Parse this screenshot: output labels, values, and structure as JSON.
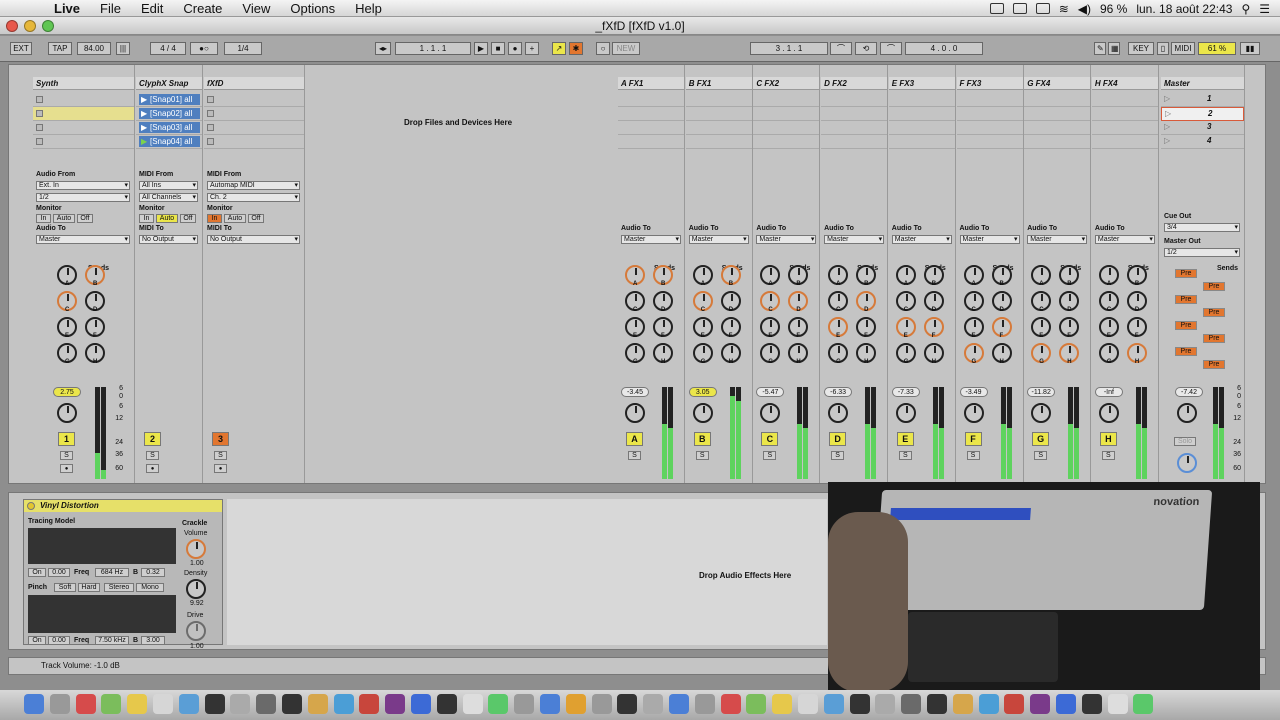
{
  "menubar": {
    "app": "Live",
    "items": [
      "File",
      "Edit",
      "Create",
      "View",
      "Options",
      "Help"
    ],
    "battery": "96 %",
    "datetime": "lun. 18 août  22:43"
  },
  "window": {
    "title": "_fXfD  [fXfD v1.0]"
  },
  "transport": {
    "ext": "EXT",
    "tap": "TAP",
    "bpm": "84.00",
    "signature": "4 / 4",
    "quant": "1/4",
    "position": "1 .  1 .  1",
    "new": "NEW",
    "loop_start": "3 .  1 .  1",
    "loop_len": "4 .  0 .  0",
    "key": "KEY",
    "midi": "MIDI",
    "cpu": "61 %"
  },
  "tracks": [
    {
      "name": "Synth",
      "from_label": "Audio From",
      "from": "Ext. In",
      "channel": "1/2",
      "to_label": "Audio To",
      "to": "Master",
      "vol": "2.75",
      "num": "1"
    },
    {
      "name": "ClyphX Snap",
      "from_label": "MIDI From",
      "from": "All Ins",
      "channel": "All Channels",
      "to_label": "MIDI To",
      "to": "No Output",
      "num": "2",
      "snaps": [
        "[Snap01] all",
        "[Snap02] all",
        "[Snap03] all",
        "[Snap04] all"
      ]
    },
    {
      "name": "fXfD",
      "from_label": "MIDI From",
      "from": "Automap MIDI",
      "channel": "Ch. 2",
      "to_label": "MIDI To",
      "to": "No Output",
      "num": "3"
    }
  ],
  "monitor": {
    "label": "Monitor",
    "in": "In",
    "auto": "Auto",
    "off": "Off"
  },
  "sends_label": "Sends",
  "send_letters": [
    "A",
    "B",
    "C",
    "D",
    "E",
    "F",
    "G",
    "H"
  ],
  "drop_clips": "Drop Files and Devices Here",
  "returns": [
    {
      "name": "A FX1",
      "vol": "-3.45",
      "letter": "A"
    },
    {
      "name": "B FX1",
      "vol": "3.05",
      "letter": "B"
    },
    {
      "name": "C FX2",
      "vol": "-5.47",
      "letter": "C"
    },
    {
      "name": "D FX2",
      "vol": "-6.33",
      "letter": "D"
    },
    {
      "name": "E FX3",
      "vol": "-7.33",
      "letter": "E"
    },
    {
      "name": "F FX3",
      "vol": "-3.49",
      "letter": "F"
    },
    {
      "name": "G FX4",
      "vol": "-11.82",
      "letter": "G"
    },
    {
      "name": "H FX4",
      "vol": "-Inf",
      "letter": "H"
    }
  ],
  "return_audio_to": "Audio To",
  "return_to": "Master",
  "master": {
    "name": "Master",
    "scenes": [
      "1",
      "2",
      "3",
      "4"
    ],
    "cue_label": "Cue Out",
    "cue": "3/4",
    "out_label": "Master Out",
    "out": "1/2",
    "vol": "-7.42",
    "solo": "Solo",
    "pre": "Pre"
  },
  "meter_scale": [
    "6",
    "0",
    "6",
    "12",
    "24",
    "36",
    "60"
  ],
  "solo_label": "S",
  "device": {
    "name": "Vinyl Distortion",
    "tracing": "Tracing Model",
    "crackle": "Crackle",
    "volume": "Volume",
    "volume_val": "1.00",
    "density": "Density",
    "density_val": "9.92",
    "drive": "Drive",
    "drive_val": "1.00",
    "on": "On",
    "v1": "0.00",
    "freq": "Freq",
    "f1": "684 Hz",
    "b": "B",
    "b1": "0.32",
    "pinch": "Pinch",
    "soft": "Soft",
    "hard": "Hard",
    "stereo": "Stereo",
    "mono": "Mono",
    "f2": "7.50 kHz",
    "b2": "3.00",
    "drop": "Drop Audio Effects Here"
  },
  "status": "Track Volume: -1.0 dB",
  "video_label": "novation",
  "colors": {
    "yellow": "#ebe64a",
    "orange": "#e2762f",
    "meter": "#5ed35e",
    "snap": "#4f7fbf"
  }
}
